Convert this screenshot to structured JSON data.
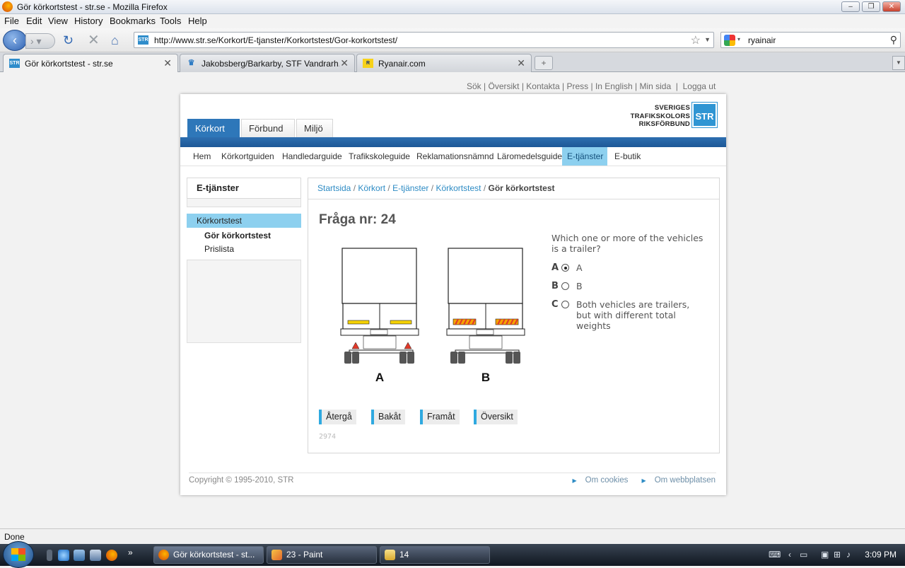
{
  "window": {
    "title": "Gör körkortstest - str.se - Mozilla Firefox"
  },
  "menu": [
    "File",
    "Edit",
    "View",
    "History",
    "Bookmarks",
    "Tools",
    "Help"
  ],
  "url": "http://www.str.se/Korkort/E-tjanster/Korkortstest/Gor-korkortstest/",
  "search": {
    "value": "ryainair"
  },
  "tabs": [
    {
      "title": "Gör körkortstest - str.se",
      "active": true,
      "icon": "str-favicon"
    },
    {
      "title": "Jakobsberg/Barkarby, STF Vandrarh...",
      "active": false,
      "icon": "stf-favicon"
    },
    {
      "title": "Ryanair.com",
      "active": false,
      "icon": "ryanair-favicon"
    }
  ],
  "site": {
    "top_links": [
      "Sök",
      "Översikt",
      "Kontakta",
      "Press",
      "In English",
      "Min sida",
      "Logga ut"
    ],
    "main_tabs": [
      "Körkort",
      "Förbund",
      "Miljö"
    ],
    "logo": {
      "line1": "SVERIGES",
      "line2": "TRAFIKSKOLORS",
      "line3": "RIKSFÖRBUND",
      "mark": "STR"
    },
    "subnav": [
      "Hem",
      "Körkortguiden",
      "Handledarguide",
      "Trafikskoleguide",
      "Reklamationsnämnd",
      "Läromedelsguide",
      "E-tjänster",
      "E-butik"
    ],
    "active_subnav": "E-tjänster",
    "sidebar": {
      "title": "E-tjänster",
      "items": [
        "Körkortstest",
        "Gör körkortstest",
        "Prislista"
      ]
    },
    "breadcrumb": [
      "Startsida",
      "Körkort",
      "E-tjänster",
      "Körkortstest",
      "Gör körkortstest"
    ],
    "question": {
      "heading": "Fråga nr: 24",
      "text": "Which one or more of the vehicles is a trailer?",
      "image_labels": [
        "A",
        "B"
      ],
      "options": [
        {
          "letter": "A",
          "text": "A",
          "selected": true
        },
        {
          "letter": "B",
          "text": "B",
          "selected": false
        },
        {
          "letter": "C",
          "text": "Both vehicles are trailers, but with different total weights",
          "selected": false
        }
      ],
      "buttons": [
        "Återgå",
        "Bakåt",
        "Framåt",
        "Översikt"
      ],
      "id": "2974"
    },
    "footer": {
      "copyright": "Copyright © 1995-2010, STR",
      "links": [
        "Om cookies",
        "Om webbplatsen"
      ]
    }
  },
  "status": "Done",
  "taskbar": {
    "items": [
      {
        "label": "Gör körkortstest - st...",
        "active": true
      },
      {
        "label": "23 - Paint",
        "active": false
      },
      {
        "label": "14",
        "active": false
      }
    ],
    "clock": "3:09 PM"
  },
  "colors": {
    "accent": "#2e77b9",
    "highlight": "#8dd0ef",
    "link": "#2d8bc4"
  }
}
